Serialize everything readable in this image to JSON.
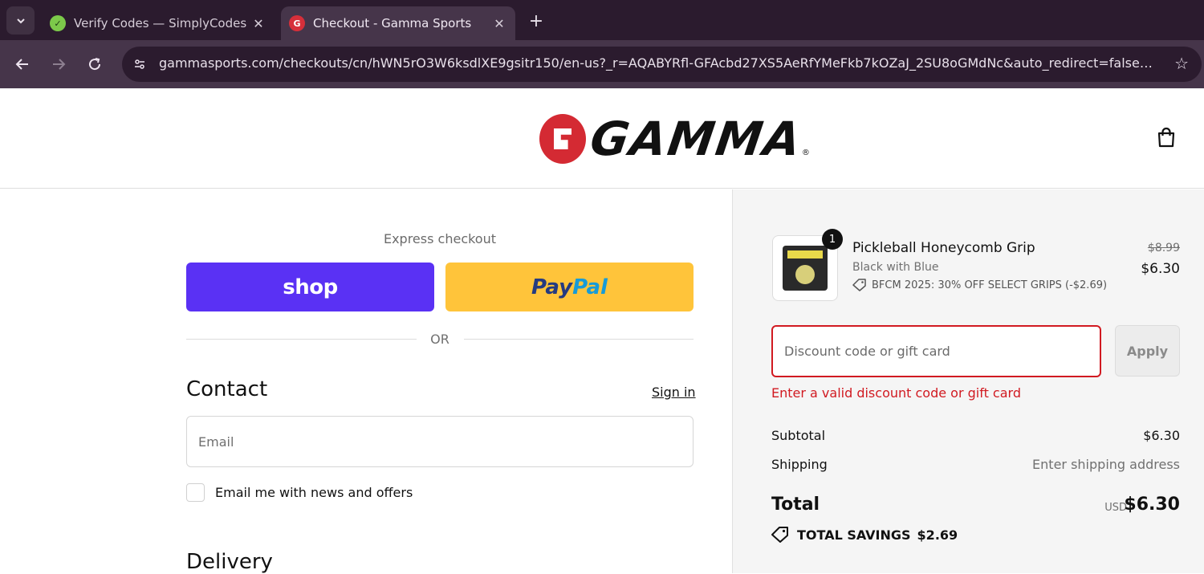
{
  "browser": {
    "tabs": [
      {
        "title": "Verify Codes — SimplyCodes",
        "favicon": "simplycodes-icon"
      },
      {
        "title": "Checkout - Gamma Sports",
        "favicon": "gamma-icon"
      }
    ],
    "url": "gammasports.com/checkouts/cn/hWN5rO3W6ksdlXE9gsitr150/en-us?_r=AQABYRfl-GFAcbd27XS5AeRfYMeFkb7kOZaJ_2SU8oGMdNc&auto_redirect=false&ed..."
  },
  "header": {
    "logo_text": "GAMMA"
  },
  "express": {
    "label": "Express checkout",
    "shop_label": "shop",
    "paypal_part1": "Pay",
    "paypal_part2": "Pal",
    "or": "OR"
  },
  "contact": {
    "heading": "Contact",
    "sign_in": "Sign in",
    "email_placeholder": "Email",
    "newsletter_label": "Email me with news and offers"
  },
  "delivery": {
    "heading": "Delivery"
  },
  "order": {
    "item": {
      "quantity": "1",
      "name": "Pickleball Honeycomb Grip",
      "variant": "Black with Blue",
      "discount": "BFCM 2025: 30% OFF SELECT GRIPS (-$2.69)",
      "original_price": "$8.99",
      "price": "$6.30"
    },
    "discount_placeholder": "Discount code or gift card",
    "apply_label": "Apply",
    "error": "Enter a valid discount code or gift card",
    "subtotal_label": "Subtotal",
    "subtotal_value": "$6.30",
    "shipping_label": "Shipping",
    "shipping_value": "Enter shipping address",
    "total_label": "Total",
    "total_currency": "USD",
    "total_value": "$6.30",
    "savings_label": "TOTAL SAVINGS",
    "savings_value": "$2.69"
  },
  "colors": {
    "shop_button": "#5a31f4",
    "paypal_button": "#ffc43a",
    "error": "#d11a21",
    "brand_red": "#d42a33"
  }
}
